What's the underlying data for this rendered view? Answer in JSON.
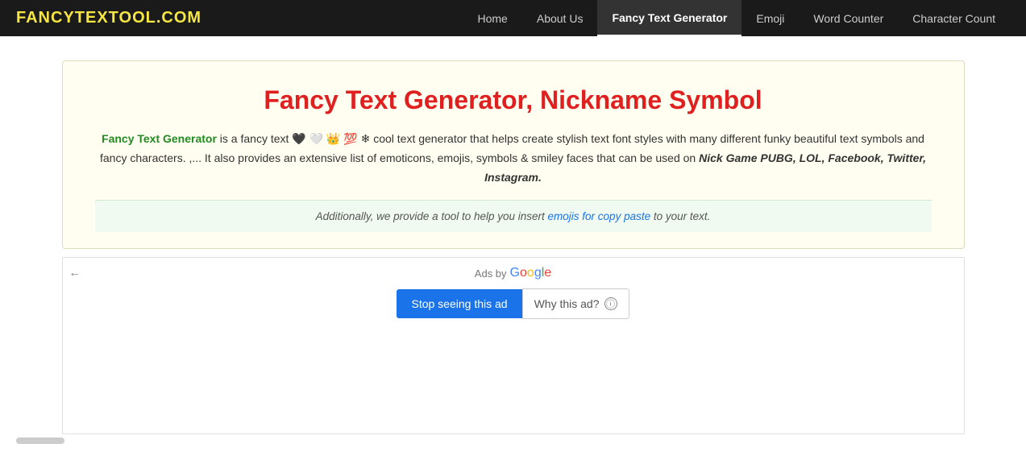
{
  "nav": {
    "logo": "FANCYTEXTOOL.COM",
    "links": [
      {
        "id": "home",
        "label": "Home",
        "active": false
      },
      {
        "id": "about-us",
        "label": "About Us",
        "active": false
      },
      {
        "id": "fancy-text-generator",
        "label": "Fancy Text Generator",
        "active": true
      },
      {
        "id": "emoji",
        "label": "Emoji",
        "active": false
      },
      {
        "id": "word-counter",
        "label": "Word Counter",
        "active": false
      },
      {
        "id": "character-count",
        "label": "Character Count",
        "active": false
      }
    ]
  },
  "hero": {
    "title": "Fancy Text Generator, Nickname Symbol",
    "fancy_label": "Fancy Text Generator",
    "desc_before": " is a fancy text 🖤 🤍 👑 💯 ❄ cool text generator that helps create stylish text font styles with many different funky beautiful text symbols and fancy characters. ,... It also provides an extensive list of emoticons, emojis, symbols & smiley faces that can be used on ",
    "desc_bold_italic": "Nick Game PUBG, LOL, Facebook, Twitter, Instagram.",
    "additional_note_before": "Additionally, we provide a tool to help you insert ",
    "additional_note_link": "emojis for copy paste",
    "additional_note_after": " to your text."
  },
  "ad": {
    "ads_by": "Ads by",
    "google_label": "Google",
    "stop_ad_label": "Stop seeing this ad",
    "why_ad_label": "Why this ad?"
  }
}
